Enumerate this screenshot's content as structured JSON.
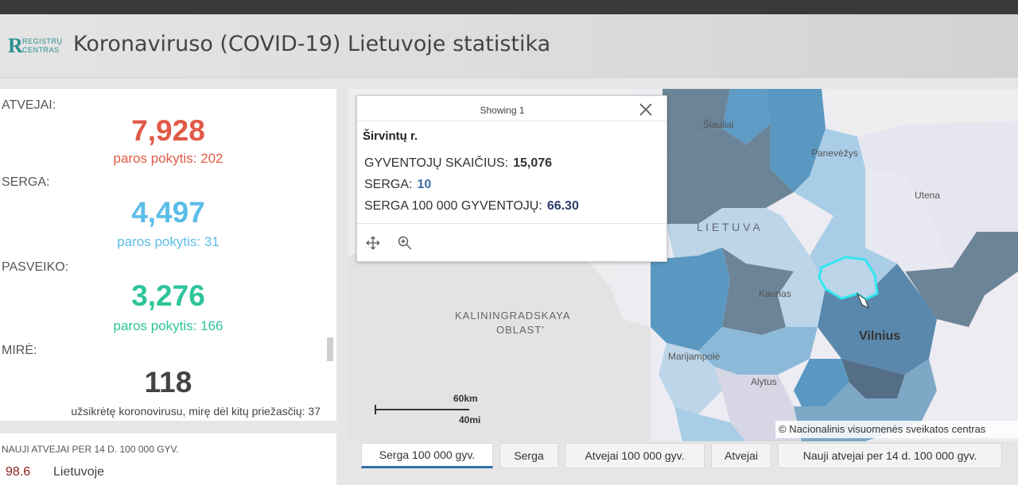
{
  "header": {
    "logo_line1": "REGISTRŲ",
    "logo_line2": "CENTRAS",
    "title": "Koronaviruso (COVID-19) Lietuvoje statistika"
  },
  "stats": {
    "atvejai": {
      "label": "ATVEJAI:",
      "value": "7,928",
      "delta": "paros pokytis: 202"
    },
    "serga": {
      "label": "SERGA:",
      "value": "4,497",
      "delta": "paros pokytis: 31"
    },
    "pasveiko": {
      "label": "PASVEIKO:",
      "value": "3,276",
      "delta": "paros pokytis: 166"
    },
    "mire": {
      "label": "MIRĖ:",
      "value": "118",
      "note": "užsikrėtę koronovirusu, mirę dėl kitų priežasčių: 37"
    }
  },
  "new_per_14d": {
    "title": "NAUJI ATVEJAI PER 14 D. 100 000 GYV.",
    "rows": [
      {
        "value": "98.6",
        "name": "Lietuvoje"
      }
    ]
  },
  "popup": {
    "showing": "Showing 1",
    "feature_name": "Širvintų r.",
    "attributes": [
      {
        "label": "GYVENTOJŲ SKAIČIUS:",
        "value": "15,076"
      },
      {
        "label": "SERGA:",
        "value": "10"
      },
      {
        "label": "SERGA 100 000 GYVENTOJŲ:",
        "value": "66.30"
      }
    ]
  },
  "map": {
    "labels": {
      "siauliai": "Šiauliai",
      "panevezys": "Panevėžys",
      "utena": "Utena",
      "lietuva": "L I E T U V A",
      "kaunas": "Kaunas",
      "vilnius": "Vilnius",
      "kaliningrad1": "KALININGRADSKAYA",
      "kaliningrad2": "OBLAST'",
      "marijampole": "Marijampolė",
      "alytus": "Alytus"
    },
    "scale_km": "60km",
    "scale_mi": "40mi",
    "attribution": "© Nacionalinis visuomenės sveikatos centras"
  },
  "tabs": [
    {
      "label": "Serga 100 000 gyv.",
      "active": true
    },
    {
      "label": "Serga"
    },
    {
      "label": "Atvejai 100 000 gyv."
    },
    {
      "label": "Atvejai"
    },
    {
      "label": "Nauji atvejai per 14 d. 100 000 gyv."
    }
  ],
  "colors": {
    "atvejai": "#e05a47",
    "serga": "#5bbde8",
    "pasveiko": "#2ec49b",
    "highlight": "#33e6f0",
    "accent": "#2e6fa8"
  }
}
